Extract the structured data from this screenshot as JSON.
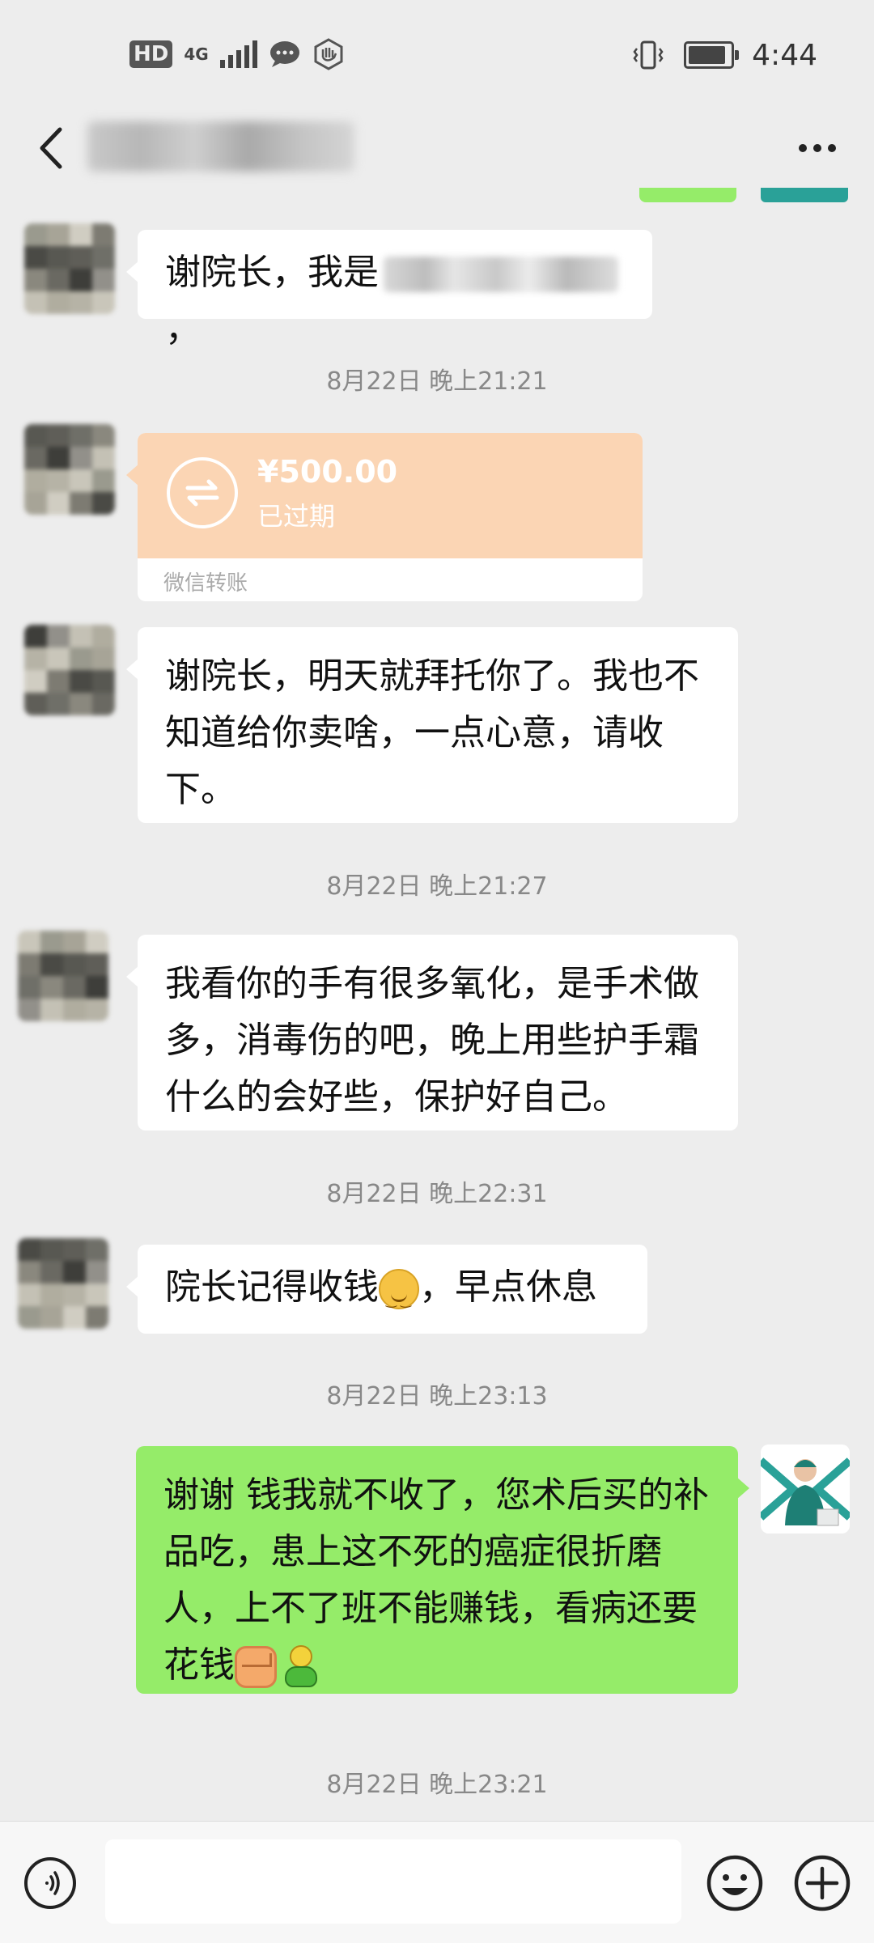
{
  "status_bar": {
    "hd_badge": "HD",
    "network": "4G",
    "time": "4:44",
    "battery_level": 0.9
  },
  "header": {
    "icons": {
      "back": "back-chevron-icon",
      "more": "more-dots-icon"
    }
  },
  "messages": [
    {
      "side": "left",
      "text": "谢院长，我是",
      "text_tail": "，"
    },
    {
      "timestamp": "8月22日 晚上21:21"
    },
    {
      "type": "transfer",
      "side": "left",
      "amount": "¥500.00",
      "status": "已过期",
      "footer": "微信转账"
    },
    {
      "side": "left",
      "lines": [
        "谢院长，明天就拜托你了。我也不",
        "知道给你卖啥，一点心意，请收",
        "下。"
      ]
    },
    {
      "timestamp": "8月22日 晚上21:27"
    },
    {
      "side": "left",
      "lines": [
        "我看你的手有很多氧化，是手术做",
        "多，消毒伤的吧，晚上用些护手霜",
        "什么的会好些，保护好自己。"
      ]
    },
    {
      "timestamp": "8月22日 晚上22:31"
    },
    {
      "side": "left",
      "text_before_emoji": "院长记得收钱",
      "emoji": "smiling-face-icon",
      "text_after_emoji": "，早点休息"
    },
    {
      "timestamp": "8月22日 晚上23:13"
    },
    {
      "side": "right",
      "lines": [
        "谢谢 钱我就不收了，您术后买的补",
        "品吃，患上这不死的癌症很折磨",
        "人，上不了班不能赚钱，看病还要"
      ],
      "last_line_text": "花钱",
      "emojis": [
        "fist-icon",
        "fighter-icon"
      ]
    },
    {
      "timestamp": "8月22日 晚上23:21"
    }
  ],
  "input_bar": {
    "placeholder": "",
    "icons": {
      "voice": "voice-icon",
      "emoji": "emoji-icon",
      "plus": "plus-icon"
    }
  },
  "colors": {
    "background": "#ededed",
    "bubble_incoming": "#ffffff",
    "bubble_outgoing": "#95ec69",
    "transfer_card": "#fbd5b4",
    "timestamp": "#888888"
  }
}
